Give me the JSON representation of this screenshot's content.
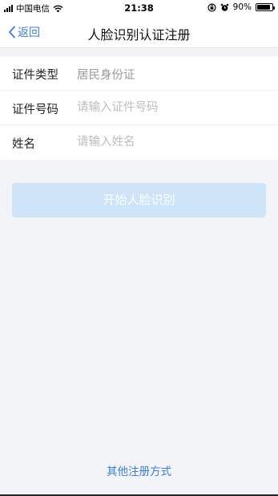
{
  "status_bar": {
    "carrier": "中国电信",
    "time": "21:38",
    "battery_text": "90%",
    "battery_level": 0.9
  },
  "nav": {
    "back_label": "返回",
    "title": "人脸识别认证注册"
  },
  "form": {
    "id_type_label": "证件类型",
    "id_type_value": "居民身份证",
    "id_number_label": "证件号码",
    "id_number_placeholder": "请输入证件号码",
    "name_label": "姓名",
    "name_placeholder": "请输入姓名"
  },
  "start_button_label": "开始人脸识别",
  "other_register_link": "其他注册方式",
  "colors": {
    "accent": "#3b7fd6",
    "button_disabled": "#cfe3f9",
    "background": "#f3f4f8"
  }
}
